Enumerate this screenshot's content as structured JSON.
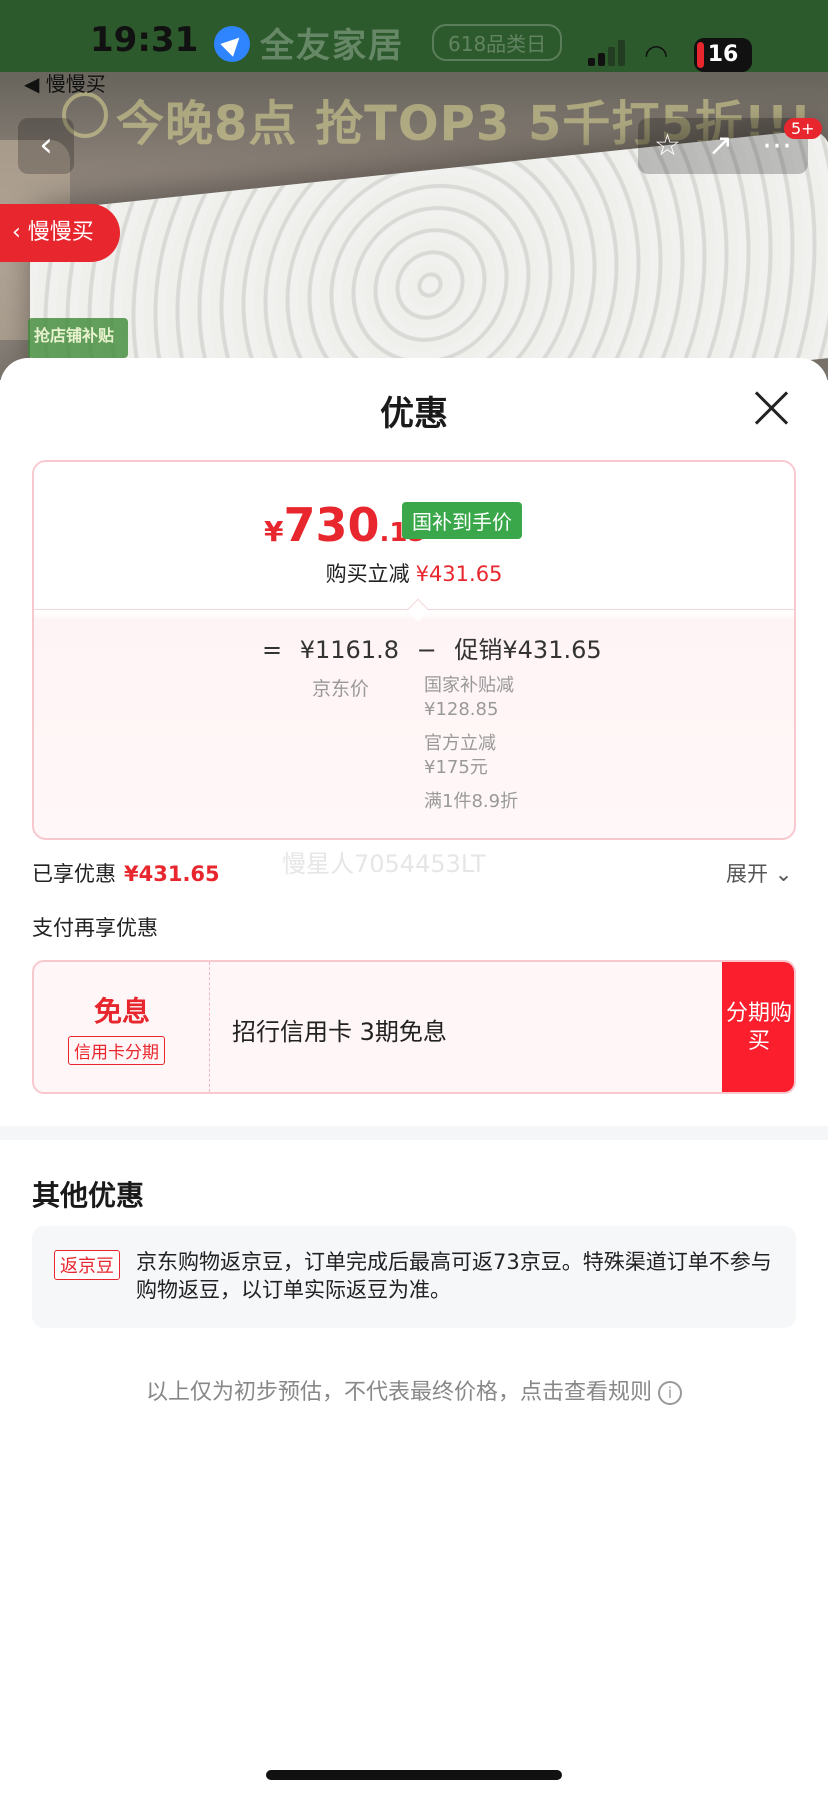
{
  "status_bar": {
    "time": "19:31",
    "battery": "16"
  },
  "background": {
    "back_app": "◀ 慢慢买",
    "brand_text": "全友家居",
    "brand_sub": "618品类日",
    "promo_text": "今晚8点 抢TOP3 5千打5折!!!",
    "shop_tag": "抢店铺补贴",
    "cart_badge": "5+",
    "side_button": "慢慢买"
  },
  "sheet": {
    "title": "优惠",
    "final_price": {
      "currency": "¥",
      "integer": "730",
      "decimal": ".15"
    },
    "gov_tag": "国补到手价",
    "buy_label": "购买立减",
    "buy_amount": "¥431.65",
    "equation": {
      "eq": "=",
      "jd_price": "¥1161.8",
      "minus": "−",
      "promo": "促销¥431.65"
    },
    "jd_label": "京东价",
    "promo_items": [
      {
        "name": "国家补贴减",
        "value": "¥128.85"
      },
      {
        "name": "官方立减",
        "value": "¥175元"
      },
      {
        "name": "满1件8.9折",
        "value": ""
      }
    ],
    "enjoyed_label": "已享优惠",
    "enjoyed_amount": "¥431.65",
    "watermark": "慢星人7054453LT",
    "expand_label": "展开",
    "pay_title": "支付再享优惠",
    "interest_free": "免息",
    "credit_tag": "信用卡分期",
    "pay_offer": "招行信用卡 3期免息",
    "installment_button": "分期购买",
    "other_title": "其他优惠",
    "bean_tag": "返京豆",
    "bean_text": "京东购物返京豆，订单完成后最高可返73京豆。特殊渠道订单不参与购物返豆，以订单实际返豆为准。",
    "note": "以上仅为初步预估，不代表最终价格，点击查看规则"
  }
}
